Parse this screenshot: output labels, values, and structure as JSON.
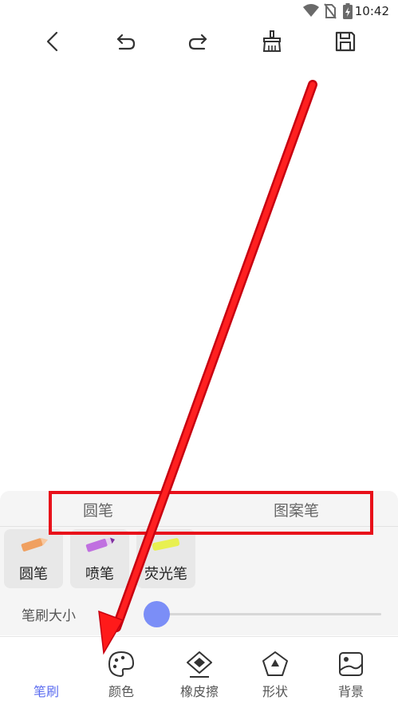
{
  "status_bar": {
    "time": "10:42"
  },
  "toolbar": {
    "back": "back-icon",
    "undo": "undo-icon",
    "redo": "redo-icon",
    "clear": "brush-clear-icon",
    "save": "save-icon"
  },
  "panel": {
    "subtabs": [
      "圆笔",
      "图案笔"
    ],
    "brushes": [
      {
        "label": "圆笔",
        "color": "#f0a060"
      },
      {
        "label": "喷笔",
        "color": "#c070e0"
      },
      {
        "label": "荧光笔",
        "color": "#e8f050"
      }
    ],
    "size_label": "笔刷大小",
    "size_value": 0.0
  },
  "bottom_nav": [
    {
      "label": "笔刷",
      "active": true
    },
    {
      "label": "颜色",
      "active": false
    },
    {
      "label": "橡皮擦",
      "active": false
    },
    {
      "label": "形状",
      "active": false
    },
    {
      "label": "背景",
      "active": false
    }
  ],
  "colors": {
    "accent": "#5b6cf0",
    "highlight_box": "#e8101a",
    "arrow": "#e8101a",
    "slider_thumb": "#7b8ef7"
  }
}
